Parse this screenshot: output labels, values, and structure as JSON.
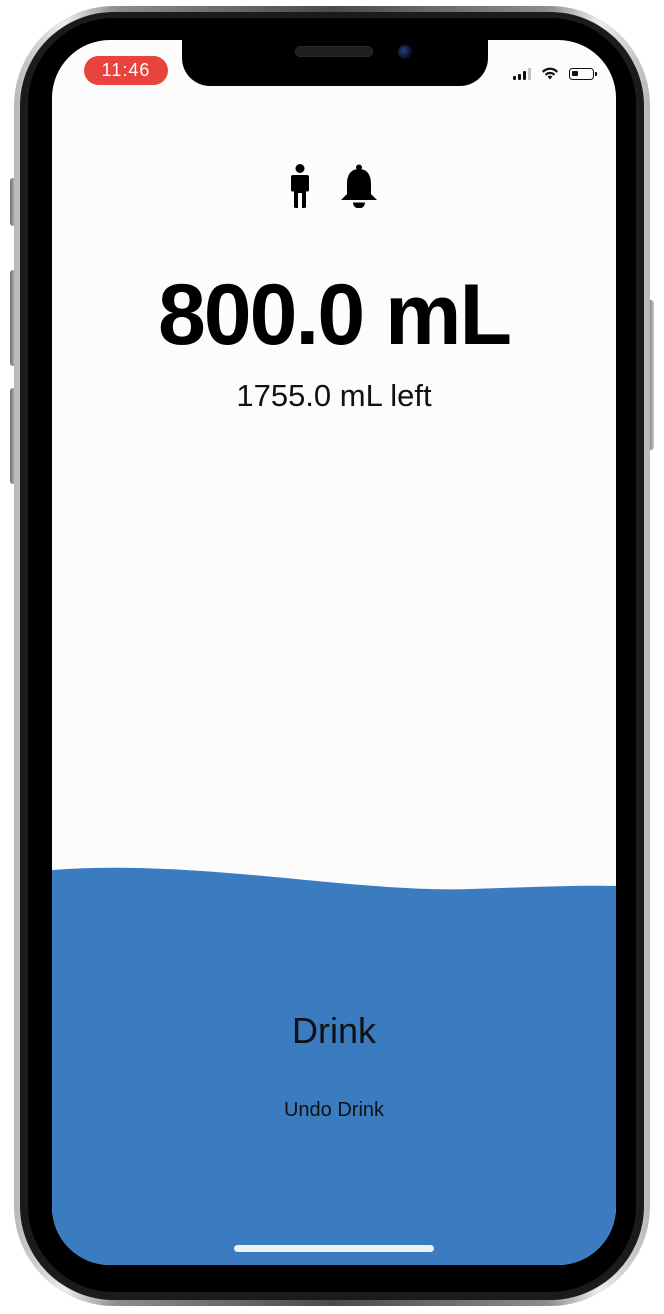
{
  "status_bar": {
    "time": "11:46",
    "time_pill_color": "#e8433c",
    "signal_icon": "cellular-signal-icon",
    "signal_bars_active": 3,
    "signal_bars_total": 4,
    "wifi_icon": "wifi-icon",
    "battery_icon": "battery-icon",
    "battery_level": 0.35
  },
  "toolbar": {
    "profile_icon": "person-icon",
    "reminders_icon": "bell-icon"
  },
  "intake": {
    "amount_label": "800.0 mL",
    "remaining_label": "1755.0 mL left"
  },
  "water": {
    "color": "#3b7cc1",
    "background": "#fcfcfd"
  },
  "actions": {
    "drink_label": "Drink",
    "undo_label": "Undo Drink"
  }
}
